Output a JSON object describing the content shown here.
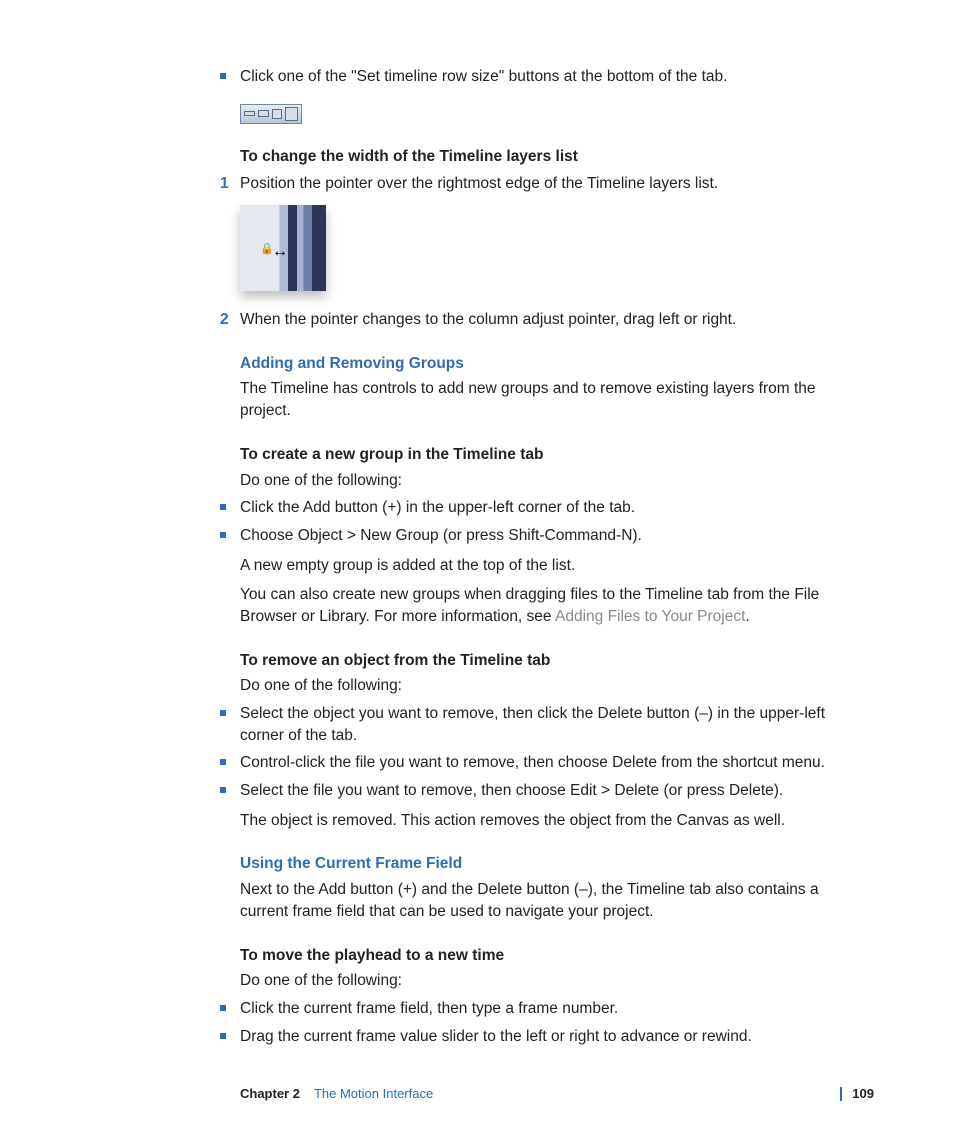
{
  "content": {
    "bullet1": "Click one of the \"Set timeline row size\" buttons at the bottom of the tab.",
    "heading_width": "To change the width of the Timeline layers list",
    "step1": "Position the pointer over the rightmost edge of the Timeline layers list.",
    "step2": "When the pointer changes to the column adjust pointer, drag left or right.",
    "sub_add_remove": "Adding and Removing Groups",
    "add_remove_para": "The Timeline has controls to add new groups and to remove existing layers from the project.",
    "heading_create_group": "To create a new group in the Timeline tab",
    "do_one1": "Do one of the following:",
    "bullet_add": "Click the Add button (+) in the upper-left corner of the tab.",
    "bullet_choose": "Choose Object > New Group (or press Shift-Command-N).",
    "new_group_added": "A new empty group is added at the top of the list.",
    "drag_files_pre": "You can also create new groups when dragging files to the Timeline tab from the File Browser or Library. For more information, see ",
    "drag_files_link": "Adding Files to Your Project",
    "drag_files_post": ".",
    "heading_remove": "To remove an object from the Timeline tab",
    "do_one2": "Do one of the following:",
    "bullet_remove1": "Select the object you want to remove, then click the Delete button (–) in the upper-left corner of the tab.",
    "bullet_remove2": "Control-click the file you want to remove, then choose Delete from the shortcut menu.",
    "bullet_remove3": "Select the file you want to remove, then choose Edit > Delete (or press Delete).",
    "remove_result": "The object is removed. This action removes the object from the Canvas as well.",
    "sub_frame": "Using the Current Frame Field",
    "frame_para": "Next to the Add button (+) and the Delete button (–), the Timeline tab also contains a current frame field that can be used to navigate your project.",
    "heading_move_playhead": "To move the playhead to a new time",
    "do_one3": "Do one of the following:",
    "bullet_frame1": "Click the current frame field, then type a frame number.",
    "bullet_frame2": "Drag the current frame value slider to the left or right to advance or rewind."
  },
  "footer": {
    "chapter": "Chapter 2",
    "title": "The Motion Interface",
    "page": "109"
  },
  "labels": {
    "num1": "1",
    "num2": "2"
  }
}
